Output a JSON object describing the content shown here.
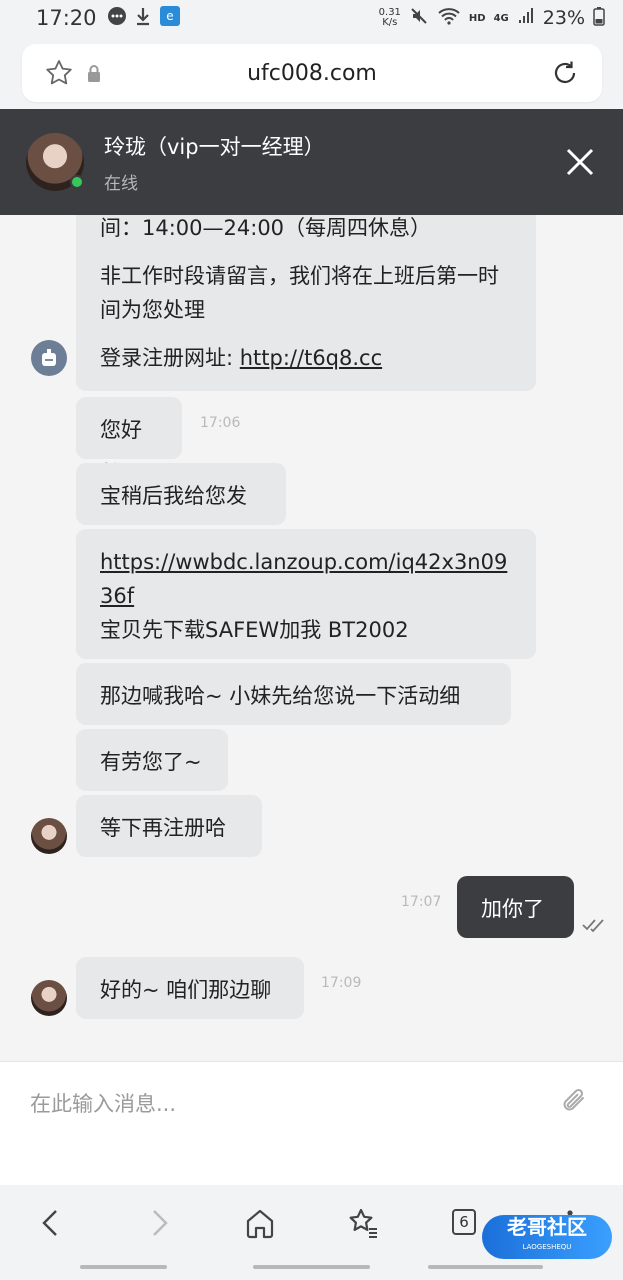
{
  "status_bar": {
    "time": "17:20",
    "net_speed_value": "0.31",
    "net_speed_unit": "K/s",
    "network": "HD",
    "signal": "4G",
    "battery": "23%"
  },
  "browser": {
    "url": "ufc008.com"
  },
  "chat_header": {
    "agent_name": "玲珑（vip一对一经理）",
    "agent_status": "在线"
  },
  "messages": {
    "m0_hours_partial": "间：14:00—24:00（每周四休息）",
    "m0_offhours": "非工作时段请留言，我们将在上班后第一时间为您处理",
    "m0_register_label": "登录注册网址: ",
    "m0_register_link": "http://t6q8.cc",
    "m1_text": "您好~",
    "m1_time": "17:06",
    "m2_text": "宝稍后我给您发",
    "m3_link": "https://wwbdc.lanzoup.com/iq42x3n0936f",
    "m3_text": "宝贝先下载SAFEW加我 BT2002",
    "m4_text": "那边喊我哈~ 小妹先给您说一下活动细",
    "m5_text": "有劳您了~",
    "m6_text": "等下再注册哈",
    "m7_text": "加你了",
    "m7_time": "17:07",
    "m8_text": "好的~ 咱们那边聊",
    "m8_time": "17:09"
  },
  "input": {
    "placeholder": "在此输入消息..."
  },
  "bottom_nav": {
    "tab_count": "6"
  },
  "watermark": {
    "title": "老哥社区",
    "subtitle": "LAOGESHEQU"
  }
}
